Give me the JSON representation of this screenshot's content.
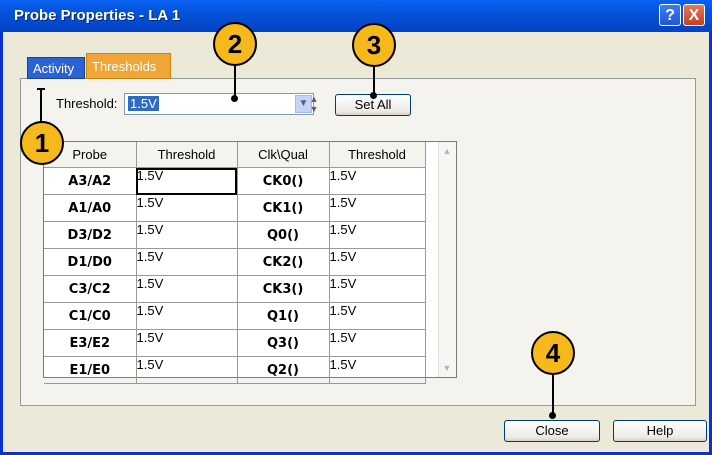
{
  "window": {
    "title": "Probe Properties - LA 1",
    "help_glyph": "?",
    "close_glyph": "X"
  },
  "tabs": {
    "activity": "Activity",
    "thresholds": "Thresholds"
  },
  "threshold_control": {
    "label": "Threshold:",
    "value": "1.5V",
    "dropdown_glyph": "▼",
    "spin_up_glyph": "▲",
    "spin_down_glyph": "▼",
    "set_all_label": "Set All"
  },
  "grid": {
    "columns": [
      "Probe",
      "Threshold",
      "Clk\\Qual",
      "Threshold"
    ],
    "rows": [
      {
        "probe": "A3/A2",
        "threshold": "1.5V",
        "clk": "CK0()",
        "clk_threshold": "1.5V"
      },
      {
        "probe": "A1/A0",
        "threshold": "1.5V",
        "clk": "CK1()",
        "clk_threshold": "1.5V"
      },
      {
        "probe": "D3/D2",
        "threshold": "1.5V",
        "clk": "Q0()",
        "clk_threshold": "1.5V"
      },
      {
        "probe": "D1/D0",
        "threshold": "1.5V",
        "clk": "CK2()",
        "clk_threshold": "1.5V"
      },
      {
        "probe": "C3/C2",
        "threshold": "1.5V",
        "clk": "CK3()",
        "clk_threshold": "1.5V"
      },
      {
        "probe": "C1/C0",
        "threshold": "1.5V",
        "clk": "Q1()",
        "clk_threshold": "1.5V"
      },
      {
        "probe": "E3/E2",
        "threshold": "1.5V",
        "clk": "Q3()",
        "clk_threshold": "1.5V"
      },
      {
        "probe": "E1/E0",
        "threshold": "1.5V",
        "clk": "Q2()",
        "clk_threshold": "1.5V"
      }
    ]
  },
  "buttons": {
    "close": "Close",
    "help": "Help"
  },
  "callouts": [
    "1",
    "2",
    "3",
    "4"
  ],
  "colors": {
    "title_bar": "#0453d8",
    "callout_fill": "#f5b91c",
    "active_tab": "#f0a537",
    "inactive_tab": "#2b63d4"
  }
}
